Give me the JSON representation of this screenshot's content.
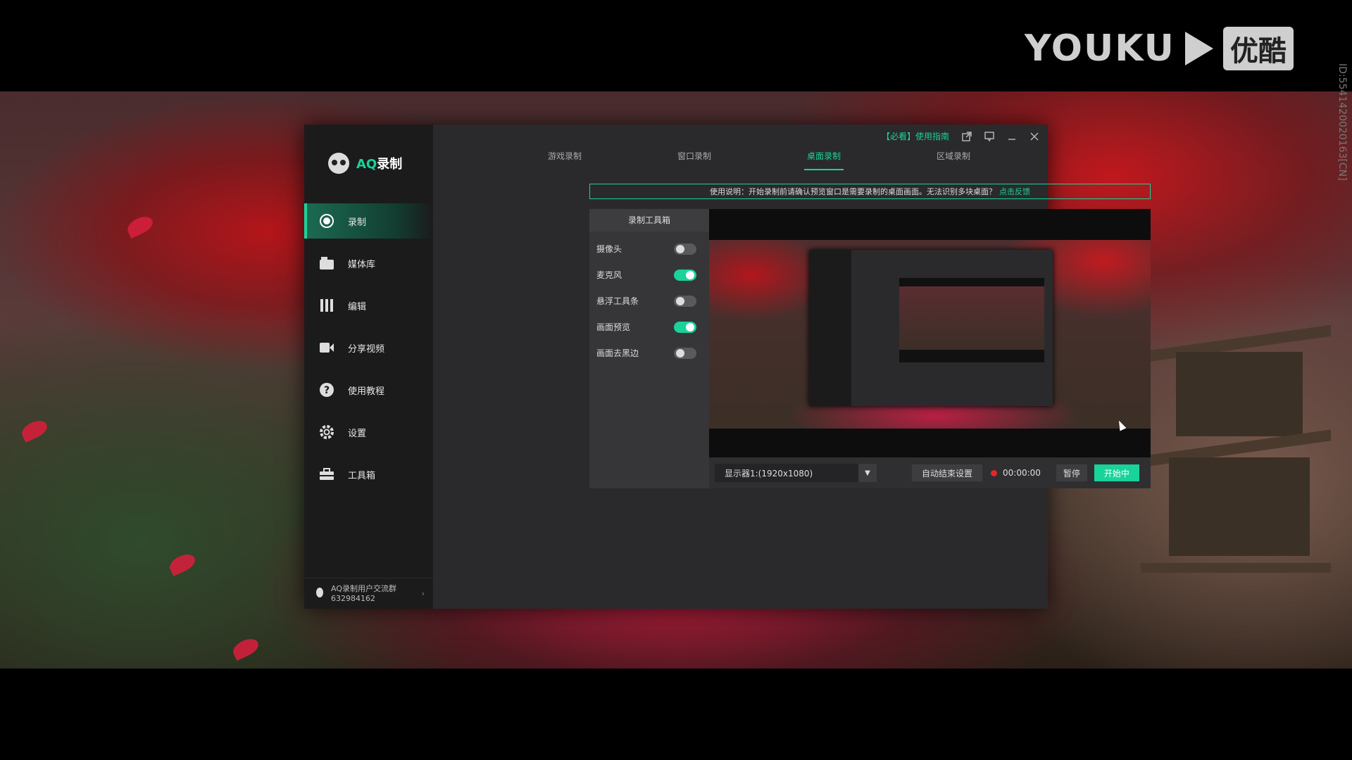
{
  "overlay": {
    "logo_text": "YOUKU",
    "logo_cn": "优酷",
    "side_id": "ID:5541420020163[CN]"
  },
  "app": {
    "brand_prefix": "AQ",
    "brand_suffix": "录制",
    "sidebar": {
      "items": [
        {
          "label": "录制",
          "icon": "record-icon",
          "active": true
        },
        {
          "label": "媒体库",
          "icon": "media-library-icon",
          "active": false
        },
        {
          "label": "编辑",
          "icon": "edit-icon",
          "active": false
        },
        {
          "label": "分享视频",
          "icon": "share-video-icon",
          "active": false
        },
        {
          "label": "使用教程",
          "icon": "help-icon",
          "active": false
        },
        {
          "label": "设置",
          "icon": "gear-icon",
          "active": false
        },
        {
          "label": "工具箱",
          "icon": "toolbox-icon",
          "active": false
        }
      ],
      "footer_line1": "AQ录制用户交流群",
      "footer_line2": "632984162"
    },
    "titlebar": {
      "guide": "【必看】使用指南"
    },
    "tabs": [
      {
        "label": "游戏录制",
        "active": false
      },
      {
        "label": "窗口录制",
        "active": false
      },
      {
        "label": "桌面录制",
        "active": true
      },
      {
        "label": "区域录制",
        "active": false
      }
    ],
    "notice": {
      "text": "使用说明：开始录制前请确认预览窗口是需要录制的桌面画面。无法识别多块桌面？",
      "link": "点击反馈"
    },
    "toolbox": {
      "title": "录制工具箱",
      "items": [
        {
          "label": "摄像头",
          "on": false
        },
        {
          "label": "麦克风",
          "on": true
        },
        {
          "label": "悬浮工具条",
          "on": false
        },
        {
          "label": "画面预览",
          "on": true
        },
        {
          "label": "画面去黑边",
          "on": false
        }
      ]
    },
    "controls": {
      "display": "显示器1:(1920x1080)",
      "auto_end": "自动结束设置",
      "timer": "00:00:00",
      "pause": "暂停",
      "start": "开始中"
    },
    "colors": {
      "accent": "#18d39a",
      "record": "#e3262c"
    }
  }
}
